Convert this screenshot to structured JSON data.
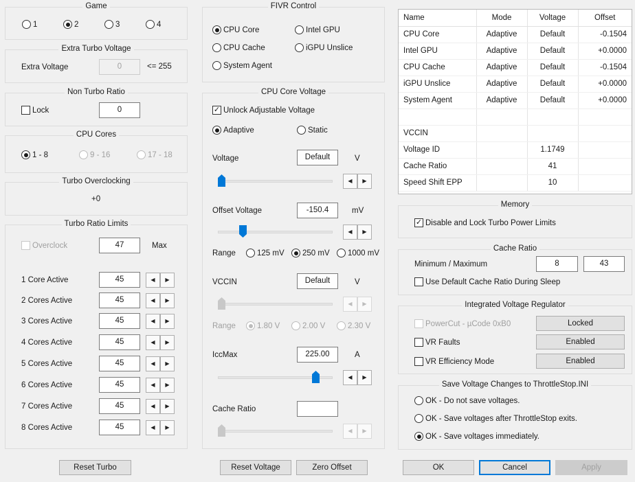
{
  "game": {
    "title": "Game",
    "options": [
      "1",
      "2",
      "3",
      "4"
    ],
    "selected": "2"
  },
  "extra_turbo": {
    "title": "Extra Turbo Voltage",
    "label": "Extra Voltage",
    "value": "0",
    "max_text": "<= 255"
  },
  "non_turbo": {
    "title": "Non Turbo Ratio",
    "lock_label": "Lock",
    "lock_checked": false,
    "value": "0"
  },
  "cpu_cores": {
    "title": "CPU Cores",
    "options": [
      "1 - 8",
      "9 - 16",
      "17 - 18"
    ],
    "selected": "1 - 8"
  },
  "turbo_oc": {
    "title": "Turbo Overclocking",
    "value": "+0"
  },
  "turbo_limits": {
    "title": "Turbo Ratio Limits",
    "overclock_label": "Overclock",
    "overclock_value": "47",
    "max_label": "Max",
    "rows": [
      {
        "label": "1 Core Active",
        "value": "45"
      },
      {
        "label": "2 Cores Active",
        "value": "45"
      },
      {
        "label": "3 Cores Active",
        "value": "45"
      },
      {
        "label": "4 Cores Active",
        "value": "45"
      },
      {
        "label": "5 Cores Active",
        "value": "45"
      },
      {
        "label": "6 Cores Active",
        "value": "45"
      },
      {
        "label": "7 Cores Active",
        "value": "45"
      },
      {
        "label": "8 Cores Active",
        "value": "45"
      }
    ],
    "reset_label": "Reset Turbo"
  },
  "fivr": {
    "title": "FIVR Control",
    "options": [
      "CPU Core",
      "Intel GPU",
      "CPU Cache",
      "iGPU Unslice",
      "System Agent"
    ],
    "selected": "CPU Core"
  },
  "core_voltage": {
    "title": "CPU Core Voltage",
    "unlock_label": "Unlock Adjustable Voltage",
    "unlock_checked": true,
    "mode_adaptive": "Adaptive",
    "mode_static": "Static",
    "mode_selected": "Adaptive",
    "voltage_label": "Voltage",
    "voltage_value": "Default",
    "voltage_unit": "V",
    "offset_label": "Offset Voltage",
    "offset_value": "-150.4",
    "offset_unit": "mV",
    "range_label": "Range",
    "range_options": [
      "125 mV",
      "250 mV",
      "1000 mV"
    ],
    "range_selected": "250 mV",
    "vccin_label": "VCCIN",
    "vccin_value": "Default",
    "vccin_unit": "V",
    "vccin_range_label": "Range",
    "vccin_range_options": [
      "1.80 V",
      "2.00 V",
      "2.30 V"
    ],
    "vccin_range_selected": "1.80 V",
    "iccmax_label": "IccMax",
    "iccmax_value": "225.00",
    "iccmax_unit": "A",
    "cache_ratio_label": "Cache Ratio",
    "cache_ratio_value": "",
    "reset_label": "Reset Voltage",
    "zero_label": "Zero Offset"
  },
  "voltage_table": {
    "headers": [
      "Name",
      "Mode",
      "Voltage",
      "Offset"
    ],
    "rows": [
      [
        "CPU Core",
        "Adaptive",
        "Default",
        "-0.1504"
      ],
      [
        "Intel GPU",
        "Adaptive",
        "Default",
        "+0.0000"
      ],
      [
        "CPU Cache",
        "Adaptive",
        "Default",
        "-0.1504"
      ],
      [
        "iGPU Unslice",
        "Adaptive",
        "Default",
        "+0.0000"
      ],
      [
        "System Agent",
        "Adaptive",
        "Default",
        "+0.0000"
      ],
      [
        "",
        "",
        "",
        ""
      ],
      [
        "VCCIN",
        "",
        "",
        ""
      ],
      [
        "Voltage ID",
        "",
        "1.1749",
        ""
      ],
      [
        "Cache Ratio",
        "",
        "41",
        ""
      ],
      [
        "Speed Shift EPP",
        "",
        "10",
        ""
      ]
    ]
  },
  "memory": {
    "title": "Memory",
    "disable_lock_label": "Disable and Lock Turbo Power Limits",
    "disable_lock_checked": true
  },
  "cache_ratio": {
    "title": "Cache Ratio",
    "minmax_label": "Minimum / Maximum",
    "min": "8",
    "max": "43",
    "sleep_label": "Use Default Cache Ratio During Sleep",
    "sleep_checked": false
  },
  "ivr": {
    "title": "Integrated Voltage Regulator",
    "powercut_label": "PowerCut  -  µCode 0xB0",
    "powercut_button": "Locked",
    "vr_faults_label": "VR Faults",
    "vr_faults_button": "Enabled",
    "vr_eff_label": "VR Efficiency Mode",
    "vr_eff_button": "Enabled"
  },
  "save": {
    "title": "Save Voltage Changes to ThrottleStop.INI",
    "options": [
      "OK - Do not save voltages.",
      "OK - Save voltages after ThrottleStop exits.",
      "OK - Save voltages immediately."
    ],
    "selected_index": 2
  },
  "dialog": {
    "ok": "OK",
    "cancel": "Cancel",
    "apply": "Apply"
  },
  "colors": {
    "slider_thumb": "#0078d7",
    "focus_border": "#0078d7"
  }
}
